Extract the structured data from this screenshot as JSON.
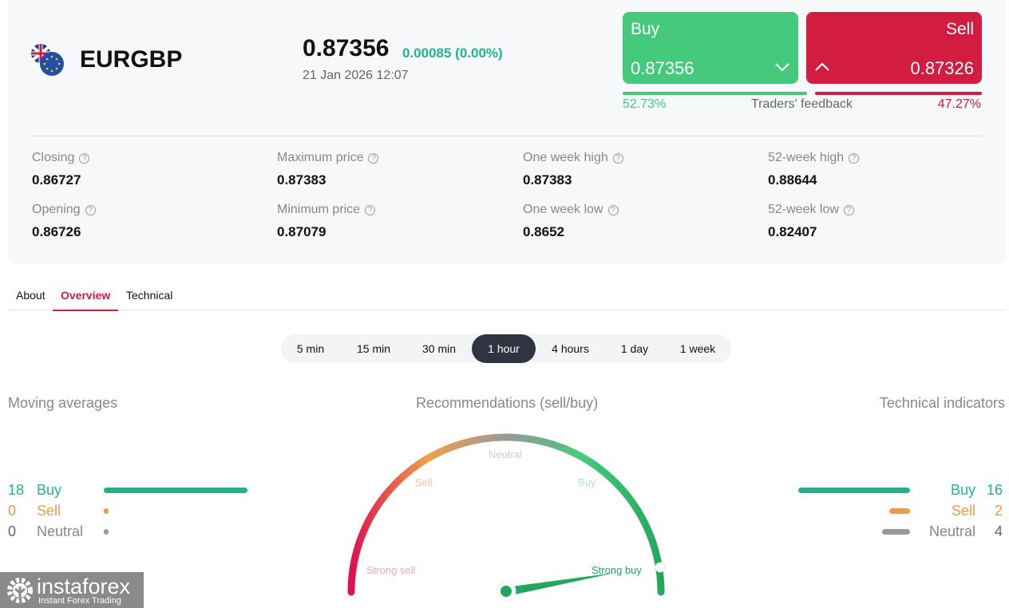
{
  "instrument": {
    "symbol": "EURGBP",
    "price": "0.87356",
    "change": "0.00085 (0.00%)",
    "datetime": "21 Jan 2026 12:07"
  },
  "trade": {
    "buy_label": "Buy",
    "buy_price": "0.87356",
    "sell_label": "Sell",
    "sell_price": "0.87326",
    "buy_pct": "52.73%",
    "sell_pct": "47.27%",
    "feedback_label": "Traders' feedback",
    "buy_share": 52.73
  },
  "stats": [
    {
      "label": "Closing",
      "value": "0.86727"
    },
    {
      "label": "Maximum price",
      "value": "0.87383"
    },
    {
      "label": "One week high",
      "value": "0.87383"
    },
    {
      "label": "52-week high",
      "value": "0.88644"
    },
    {
      "label": "Opening",
      "value": "0.86726"
    },
    {
      "label": "Minimum price",
      "value": "0.87079"
    },
    {
      "label": "One week low",
      "value": "0.8652"
    },
    {
      "label": "52-week low",
      "value": "0.82407"
    }
  ],
  "tabs": [
    {
      "label": "About"
    },
    {
      "label": "Overview",
      "active": true
    },
    {
      "label": "Technical"
    }
  ],
  "timeframes": [
    "5 min",
    "15 min",
    "30 min",
    "1 hour",
    "4 hours",
    "1 day",
    "1 week"
  ],
  "active_timeframe": "1 hour",
  "moving_averages": {
    "title": "Moving averages",
    "rows": [
      {
        "count": "18",
        "label": "Buy"
      },
      {
        "count": "0",
        "label": "Sell"
      },
      {
        "count": "0",
        "label": "Neutral"
      }
    ]
  },
  "technical_indicators": {
    "title": "Technical indicators",
    "rows": [
      {
        "count": "16",
        "label": "Buy"
      },
      {
        "count": "2",
        "label": "Sell"
      },
      {
        "count": "4",
        "label": "Neutral"
      }
    ]
  },
  "gauge": {
    "title": "Recommendations (sell/buy)",
    "labels": {
      "strong_sell": "Strong sell",
      "sell": "Sell",
      "neutral": "Neutral",
      "buy": "Buy",
      "strong_buy": "Strong buy"
    },
    "reading": "Strong buy"
  },
  "colors": {
    "buy": "#1fb58a",
    "sell": "#ef9a4a",
    "neutral": "#999999",
    "buy_button": "#45c97c",
    "sell_button": "#d21c40"
  },
  "logo": {
    "name": "instaforex",
    "tagline": "Instant Forex Trading"
  }
}
